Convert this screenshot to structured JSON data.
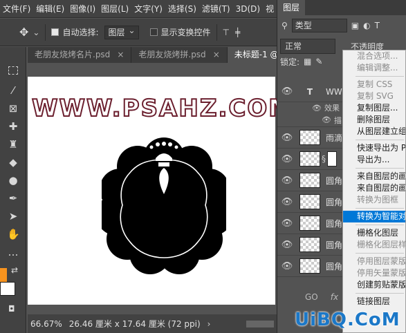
{
  "menubar": {
    "items": [
      "文件(F)",
      "编辑(E)",
      "图像(I)",
      "图层(L)",
      "文字(Y)",
      "选择(S)",
      "滤镜(T)",
      "3D(D)",
      "视"
    ]
  },
  "options": {
    "auto_select_label": "自动选择:",
    "auto_select_value": "图层",
    "show_transform_label": "显示变换控件"
  },
  "tabs": [
    {
      "label": "老朋友烧烤名片.psd",
      "close": "×"
    },
    {
      "label": "老朋友烧烤拼.psd",
      "close": "×"
    },
    {
      "label": "未标题-1 @",
      "close": ""
    }
  ],
  "canvas": {
    "headline": "WWW.PSAHZ.COM",
    "shape_fill": "#000000",
    "headline_stroke": "#6b1f2e"
  },
  "status": {
    "zoom": "66.67%",
    "doc_info": "26.46 厘米 x 17.64 厘米 (72 ppi)"
  },
  "panel": {
    "tab": "图层",
    "kind": "类型",
    "blend": "正常",
    "opacity_label": "不透明度",
    "lock_label": "锁定:",
    "layers": [
      {
        "type": "text",
        "name": "WW"
      },
      {
        "type": "effects",
        "label": "效果"
      },
      {
        "type": "effect-item",
        "label": "描"
      },
      {
        "type": "image",
        "name": "雨滴"
      },
      {
        "type": "image",
        "name": ""
      },
      {
        "type": "image",
        "name": "圆角"
      },
      {
        "type": "image",
        "name": "圆角"
      },
      {
        "type": "image",
        "name": "圆角"
      },
      {
        "type": "image",
        "name": "圆角"
      },
      {
        "type": "image",
        "name": "圆角"
      }
    ],
    "footer": {
      "link": "GO",
      "fx": "fx"
    }
  },
  "context_menu": {
    "items": [
      {
        "label": "混合选项...",
        "disabled": true
      },
      {
        "label": "编辑调整...",
        "disabled": true
      },
      {
        "sep": true
      },
      {
        "label": "复制 CSS",
        "disabled": true
      },
      {
        "label": "复制 SVG",
        "disabled": true
      },
      {
        "label": "复制图层...",
        "disabled": false
      },
      {
        "label": "删除图层",
        "disabled": false
      },
      {
        "label": "从图层建立组...",
        "disabled": false
      },
      {
        "sep": true
      },
      {
        "label": "快速导出为 P",
        "disabled": false
      },
      {
        "label": "导出为...",
        "disabled": false
      },
      {
        "sep": true
      },
      {
        "label": "来自图层的画",
        "disabled": false
      },
      {
        "label": "来自图层的画",
        "disabled": false
      },
      {
        "label": "转换为图框",
        "disabled": true
      },
      {
        "sep": true
      },
      {
        "label": "转换为智能对",
        "disabled": false,
        "highlight": true
      },
      {
        "sep": true
      },
      {
        "label": "栅格化图层",
        "disabled": false
      },
      {
        "label": "栅格化图层样",
        "disabled": true
      },
      {
        "sep": true
      },
      {
        "label": "停用图层蒙版",
        "disabled": true
      },
      {
        "label": "停用矢量蒙版",
        "disabled": true
      },
      {
        "label": "创建剪贴蒙版",
        "disabled": false
      },
      {
        "sep": true
      },
      {
        "label": "链接图层",
        "disabled": false
      }
    ]
  },
  "watermark": "UiBQ.CoM",
  "colors": {
    "accent": "#0078d7",
    "fg_swatch": "#f7931e"
  }
}
